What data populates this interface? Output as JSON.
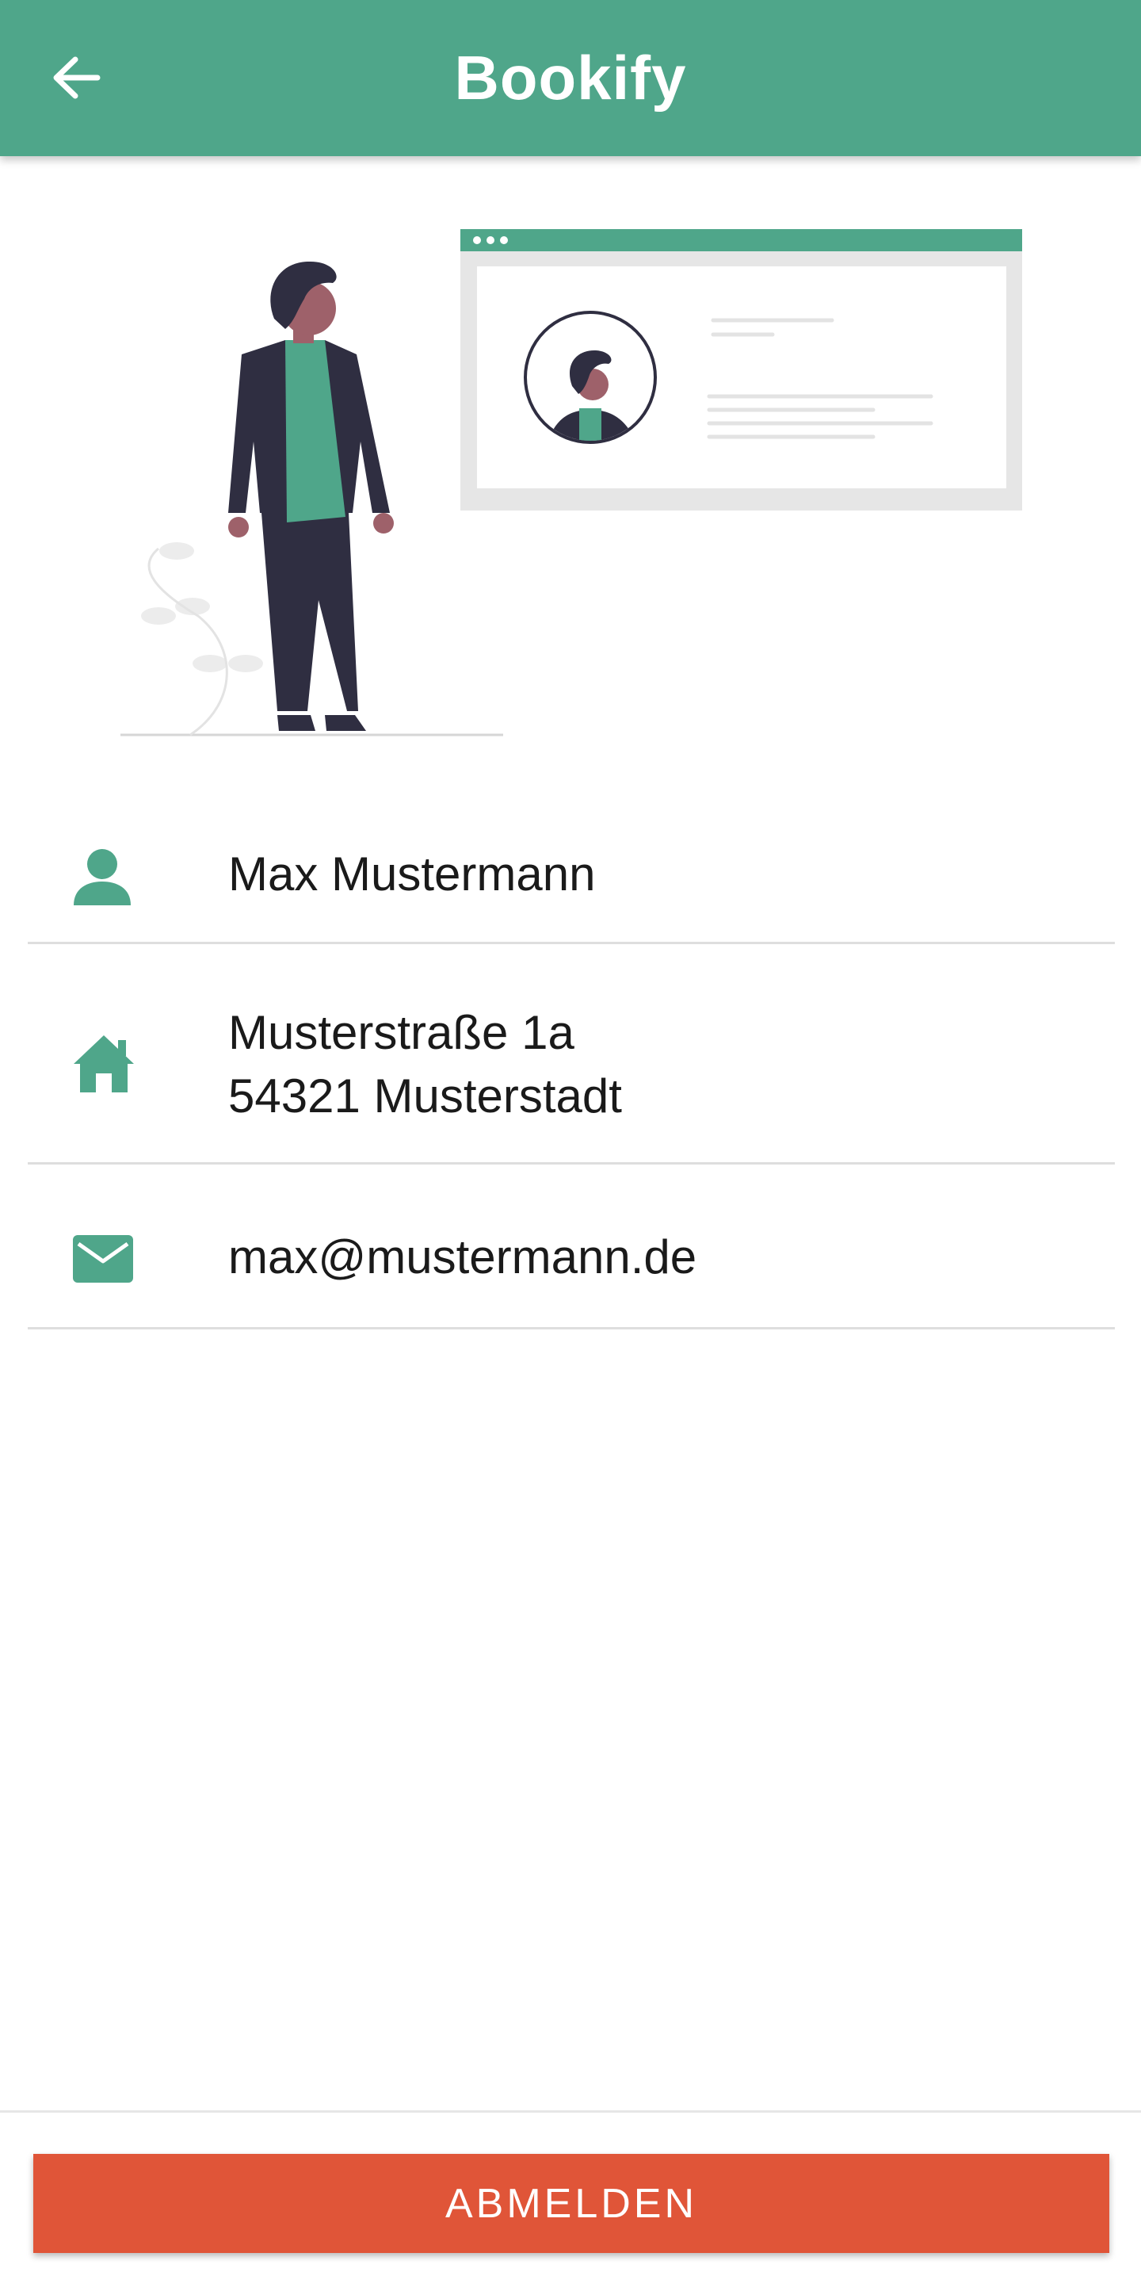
{
  "header": {
    "title": "Bookify",
    "back_icon": "arrow-left-icon",
    "color": "#4fa68a"
  },
  "illustration": {
    "name": "profile-illustration",
    "accent": "#4fa68a"
  },
  "profile": {
    "name": {
      "icon": "person-icon",
      "value": "Max Mustermann"
    },
    "address": {
      "icon": "home-icon",
      "line1": "Musterstraße 1a",
      "line2": "54321 Musterstadt"
    },
    "email": {
      "icon": "mail-icon",
      "value": "max@mustermann.de"
    }
  },
  "footer": {
    "logout_label": "ABMELDEN",
    "button_color": "#e05538"
  }
}
